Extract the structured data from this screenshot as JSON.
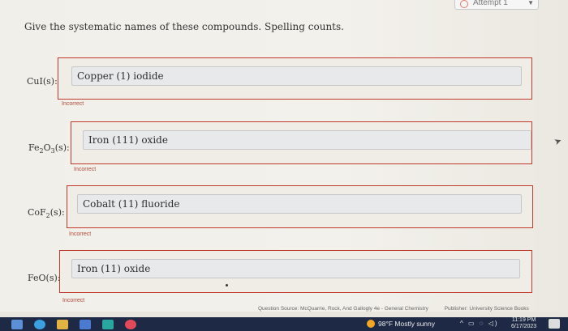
{
  "header": {
    "attempt_label": "Attempt 1"
  },
  "question": {
    "prompt": "Give the systematic names of these compounds. Spelling counts."
  },
  "items": [
    {
      "formula_html": "CuI(s):",
      "answer": "Copper (1) iodide",
      "feedback": "Incorrect"
    },
    {
      "formula_html": "Fe<sub>2</sub>O<sub>3</sub>(s):",
      "answer": "Iron (111) oxide",
      "feedback": "Incorrect"
    },
    {
      "formula_html": "CoF<sub>2</sub>(s):",
      "answer": "Cobalt (11) fluoride",
      "feedback": "Incorrect"
    },
    {
      "formula_html": "FeO(s):",
      "answer": "Iron (11) oxide",
      "feedback": "Incorrect"
    }
  ],
  "footer": {
    "source": "Question Source: McQuarrie, Rock, And Gallogly 4e - General Chemistry",
    "publisher": "Publisher: University Science Books"
  },
  "taskbar": {
    "weather": "98°F Mostly sunny",
    "time": "11:19 PM",
    "date": "6/17/2023"
  },
  "colors": {
    "error_border": "#c0392b",
    "taskbar": "#1e2a45"
  }
}
